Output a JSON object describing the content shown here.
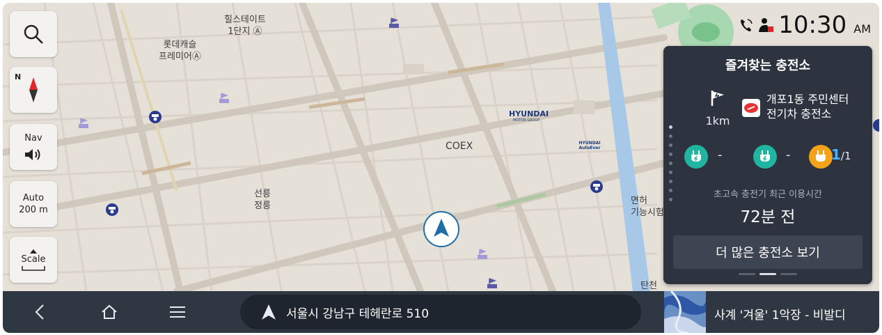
{
  "colors": {
    "map_bg": "#e6e1d8",
    "road": "#d2cbc0",
    "panel_bg": "#2d3440",
    "bottom_bar": "#2f3743",
    "ev_green": "#1fb5a0",
    "ev_orange": "#f5a21b",
    "available_blue": "#4cb4ff",
    "compass_red": "#e02626"
  },
  "map": {
    "labels": [
      {
        "id": "hillstate",
        "text": "힐스테이트\n1단지 Ⓐ"
      },
      {
        "id": "lotte",
        "text": "롯데캐슬\n프레미어Ⓐ"
      },
      {
        "id": "coex",
        "text": "COEX"
      },
      {
        "id": "seolleung",
        "text": "선릉\n정릉"
      },
      {
        "id": "myeonheo",
        "text": "면허\n기능시험"
      },
      {
        "id": "tancheon",
        "text": "탄천"
      },
      {
        "id": "hyundai",
        "text": "HYUNDAI"
      },
      {
        "id": "hyundai_sub",
        "text": "MOTOR GROUP"
      },
      {
        "id": "autoever",
        "text": "HYUNDAI AutoEver"
      }
    ],
    "controls": {
      "search_icon": "search-icon",
      "compass_label": "N",
      "nav_label": "Nav",
      "volume_icon": "volume-icon",
      "auto_label": "Auto",
      "auto_scale": "200 m",
      "scale_label": "Scale"
    }
  },
  "status": {
    "time": "10:30",
    "ampm": "AM",
    "icons": [
      "phone-icon",
      "driver-profile-icon"
    ]
  },
  "panel": {
    "title": "즐겨찾는 충전소",
    "distance": "1km",
    "station_line1": "개포1동 주민센터",
    "station_line2": "전기차 충전소",
    "chargers": [
      {
        "icon": "ev-plug-icon",
        "color": "#1fb5a0",
        "status": "-"
      },
      {
        "icon": "ev-plug-icon",
        "color": "#1fb5a0",
        "status": "-"
      },
      {
        "icon": "ev-plug-icon",
        "color": "#f5a21b",
        "available": "1",
        "total": "/1"
      }
    ],
    "usage_label": "초고속 충전기 최근 이용시간",
    "usage_value": "72분 전",
    "more_button": "더 많은 충전소 보기"
  },
  "bottom": {
    "back_icon": "back-icon",
    "home_icon": "home-icon",
    "menu_icon": "menu-icon",
    "address": "서울시 강남구 테헤란로 510",
    "track": "사계 '겨울' 1악장 - 비발디"
  }
}
